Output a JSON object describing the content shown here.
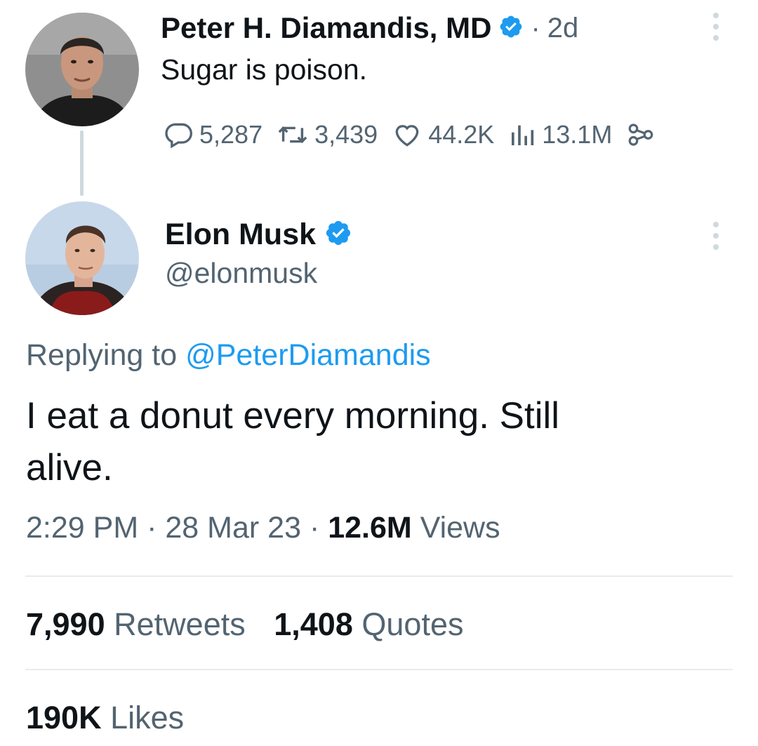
{
  "parent_tweet": {
    "author_name": "Peter H. Diamandis, MD",
    "separator": "·",
    "time_ago": "2d",
    "text": "Sugar is poison.",
    "replies": "5,287",
    "retweets": "3,439",
    "likes": "44.2K",
    "views": "13.1M"
  },
  "main_tweet": {
    "author_name": "Elon Musk",
    "handle": "@elonmusk",
    "replying_prefix": "Replying to",
    "replying_handle": "@PeterDiamandis",
    "text_line1": "I eat a donut every morning. Still",
    "text_line2": "alive.",
    "time": "2:29 PM",
    "dot1": "·",
    "date": "28 Mar 23",
    "dot2": "·",
    "views_count": "12.6M",
    "views_label": "Views",
    "retweets_count": "7,990",
    "retweets_label": "Retweets",
    "quotes_count": "1,408",
    "quotes_label": "Quotes",
    "likes_count": "190K",
    "likes_label": "Likes"
  },
  "colors": {
    "verified_blue": "#1d9bf0",
    "link_blue": "#1d9bf0",
    "muted_text": "#536471",
    "divider": "#e7ecef"
  },
  "icons": [
    "verified-badge-icon",
    "more-icon",
    "reply-icon",
    "retweet-icon",
    "like-icon",
    "views-icon",
    "share-icon"
  ]
}
